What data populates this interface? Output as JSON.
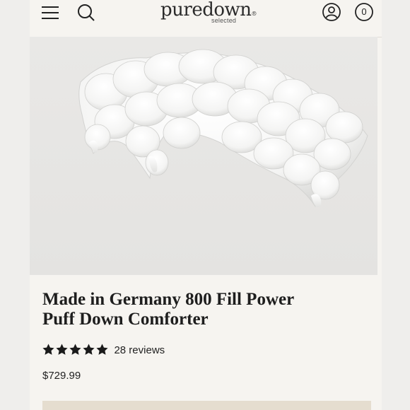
{
  "header": {
    "logo_text": "puredown",
    "logo_sub": "selected",
    "cart_count": "0"
  },
  "product": {
    "title_line1": "Made in Germany 800 Fill Power",
    "title_line2": "Puff Down Comforter",
    "rating": 5,
    "reviews_label": "28 reviews",
    "price": "$729.99"
  }
}
